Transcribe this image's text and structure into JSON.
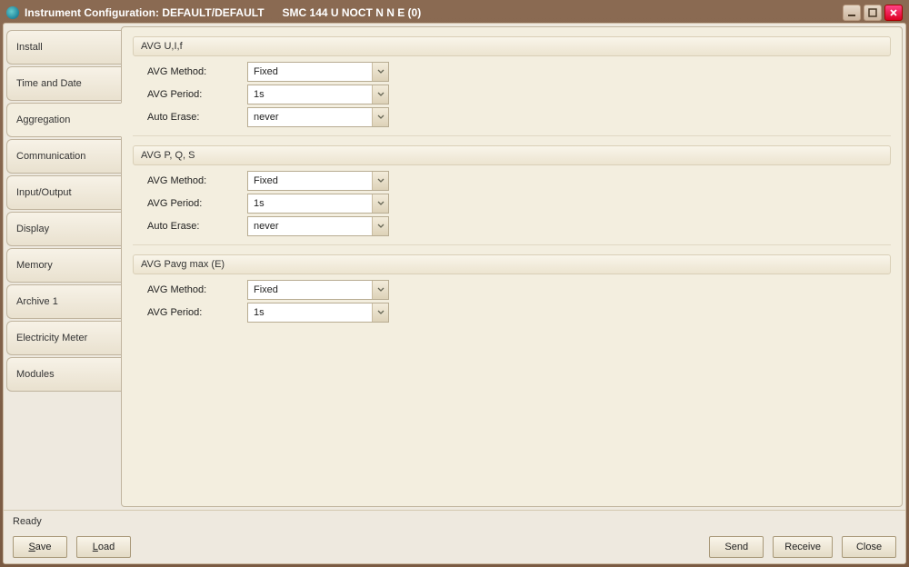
{
  "window": {
    "title": "Instrument Configuration: DEFAULT/DEFAULT      SMC 144 U NOCT N N E (0)"
  },
  "sidebar": {
    "tabs": [
      {
        "label": "Install",
        "active": false
      },
      {
        "label": "Time and Date",
        "active": false
      },
      {
        "label": "Aggregation",
        "active": true
      },
      {
        "label": "Communication",
        "active": false
      },
      {
        "label": "Input/Output",
        "active": false
      },
      {
        "label": "Display",
        "active": false
      },
      {
        "label": "Memory",
        "active": false
      },
      {
        "label": "Archive 1",
        "active": false
      },
      {
        "label": "Electricity Meter",
        "active": false
      },
      {
        "label": "Modules",
        "active": false
      }
    ]
  },
  "groups": [
    {
      "title": "AVG U,I,f",
      "rows": [
        {
          "label": "AVG Method:",
          "value": "Fixed"
        },
        {
          "label": "AVG Period:",
          "value": "1s"
        },
        {
          "label": "Auto Erase:",
          "value": "never"
        }
      ]
    },
    {
      "title": "AVG P, Q, S",
      "rows": [
        {
          "label": "AVG Method:",
          "value": "Fixed"
        },
        {
          "label": "AVG Period:",
          "value": "1s"
        },
        {
          "label": "Auto Erase:",
          "value": "never"
        }
      ]
    },
    {
      "title": "AVG Pavg max (E)",
      "rows": [
        {
          "label": "AVG Method:",
          "value": "Fixed"
        },
        {
          "label": "AVG Period:",
          "value": "1s"
        }
      ]
    }
  ],
  "status": "Ready",
  "buttons": {
    "save": "Save",
    "load": "Load",
    "send": "Send",
    "receive": "Receive",
    "close": "Close"
  }
}
